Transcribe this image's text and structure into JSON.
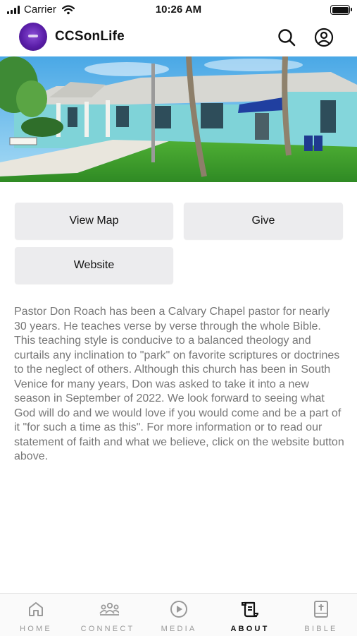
{
  "status_bar": {
    "carrier": "Carrier",
    "time": "10:26 AM"
  },
  "app_bar": {
    "title": "CCSonLife",
    "search_icon": "search-icon",
    "profile_icon": "account-icon"
  },
  "buttons": {
    "view_map": "View Map",
    "give": "Give",
    "website": "Website"
  },
  "about": {
    "description": "Pastor Don Roach has been a Calvary Chapel pastor for nearly 30 years. He teaches verse by verse through the whole Bible. This teaching style is conducive to a balanced theology and curtails any inclination to \"park\" on favorite scriptures or doctrines to the neglect of others. Although this church has been in South Venice for many years, Don was asked to take it into a new season in September of 2022. We look forward to seeing what God will do and we would love if you would come and be a part of it \"for such a time as this\". For more information or to read our statement of faith and what we believe, click on the website button above."
  },
  "tabs": [
    {
      "label": "HOME",
      "icon": "home-icon",
      "active": false
    },
    {
      "label": "CONNECT",
      "icon": "people-icon",
      "active": false
    },
    {
      "label": "MEDIA",
      "icon": "play-icon",
      "active": false
    },
    {
      "label": "ABOUT",
      "icon": "scroll-icon",
      "active": true
    },
    {
      "label": "BIBLE",
      "icon": "bible-icon",
      "active": false
    }
  ],
  "colors": {
    "accent_logo": "#5a1ea8",
    "button_bg": "#ececee",
    "body_text": "#777777",
    "building": "#7fd3d8",
    "sky": "#5cb6ea",
    "lawn": "#3d9a2e"
  }
}
